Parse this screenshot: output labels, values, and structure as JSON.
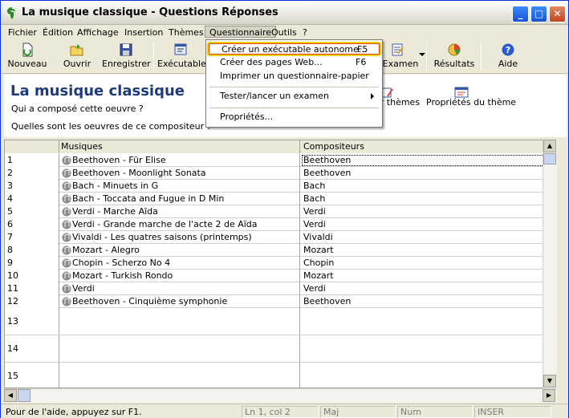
{
  "window": {
    "title": "La musique classique - Questions Réponses",
    "controls": {
      "minimize": "_",
      "maximize": "□",
      "close": "✕"
    }
  },
  "menubar": {
    "items": [
      "Fichier",
      "Édition",
      "Affichage",
      "Insertion",
      "Thèmes",
      "Questionnaire",
      "Outils",
      "?"
    ],
    "active": "Questionnaire"
  },
  "toolbar": {
    "buttons": [
      {
        "label": "Nouveau",
        "icon": "new-document-icon"
      },
      {
        "label": "Ouvrir",
        "icon": "open-folder-icon"
      },
      {
        "label": "Enregistrer",
        "icon": "save-floppy-icon"
      },
      {
        "label": "Exécutable",
        "icon": "executable-icon"
      },
      {
        "label": "Examen",
        "icon": "exam-icon"
      },
      {
        "label": "Résultats",
        "icon": "results-chart-icon"
      },
      {
        "label": "Aide",
        "icon": "help-icon"
      }
    ]
  },
  "header": {
    "title": "La musique classique",
    "question1": "Qui a composé cette oeuvre ?",
    "question2": "Quelles sont les oeuvres de ce compositeur ?",
    "right1": "er thèmes",
    "right2": "Propriétés du thème"
  },
  "dropdown": {
    "items": [
      {
        "label": "Créer un exécutable autonome...",
        "shortcut": "F5"
      },
      {
        "label": "Créer des pages Web...",
        "shortcut": "F6"
      },
      {
        "label": "Imprimer un questionnaire-papier",
        "shortcut": ""
      },
      {
        "label": "Tester/lancer un examen",
        "shortcut": ""
      },
      {
        "label": "Propriétés...",
        "shortcut": ""
      }
    ]
  },
  "grid": {
    "columns": [
      "Musiques",
      "Compositeurs"
    ],
    "rows": [
      {
        "n": "1",
        "music": "Beethoven - Für Elise",
        "composer": "Beethoven"
      },
      {
        "n": "2",
        "music": "Beethoven - Moonlight Sonata",
        "composer": "Beethoven"
      },
      {
        "n": "3",
        "music": "Bach - Minuets in G",
        "composer": "Bach"
      },
      {
        "n": "4",
        "music": "Bach - Toccata and Fugue in D Min",
        "composer": "Bach"
      },
      {
        "n": "5",
        "music": "Verdi - Marche Aïda",
        "composer": "Verdi"
      },
      {
        "n": "6",
        "music": "Verdi - Grande marche de l'acte 2 de Aïda",
        "composer": "Verdi"
      },
      {
        "n": "7",
        "music": "Vivaldi - Les quatres saisons (printemps)",
        "composer": "Vivaldi"
      },
      {
        "n": "8",
        "music": "Mozart - Alegro",
        "composer": "Mozart"
      },
      {
        "n": "9",
        "music": "Chopin - Scherzo No 4",
        "composer": "Chopin"
      },
      {
        "n": "10",
        "music": "Mozart - Turkish Rondo",
        "composer": "Mozart"
      },
      {
        "n": "11",
        "music": "Verdi",
        "composer": "Verdi"
      },
      {
        "n": "12",
        "music": "Beethoven - Cinquième symphonie",
        "composer": "Beethoven"
      }
    ],
    "empty_rows": [
      "13",
      "14",
      "15"
    ]
  },
  "statusbar": {
    "help": "Pour de l'aide, appuyez sur F1.",
    "position": "Ln 1, col 2",
    "maj": "Maj",
    "num": "Num",
    "inser": "INSER"
  }
}
